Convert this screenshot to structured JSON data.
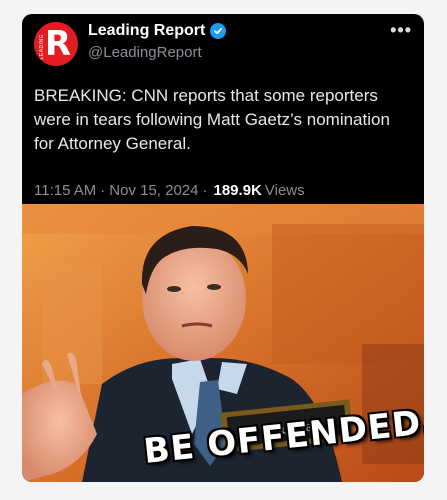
{
  "post": {
    "display_name": "Leading Report",
    "handle": "@LeadingReport",
    "text": "BREAKING: CNN reports that some reporters were in tears following Matt Gaetz’s nomination for Attorney General.",
    "time": "11:15 AM",
    "separator": "·",
    "date": "Nov 15, 2024",
    "views_count": "189.9K",
    "views_label": "Views",
    "more_icon": "more-icon",
    "verified_icon": "verified-badge-icon"
  },
  "avatar": {
    "letter": "R",
    "small_text": "LEADING"
  },
  "image": {
    "nameplate": "MR. GAETZ",
    "caption": "BE OFFENDED."
  },
  "colors": {
    "card_bg": "#000000",
    "brand_red": "#e31b23",
    "verified_blue": "#1d9bf0",
    "muted_text": "#8b8f94"
  }
}
